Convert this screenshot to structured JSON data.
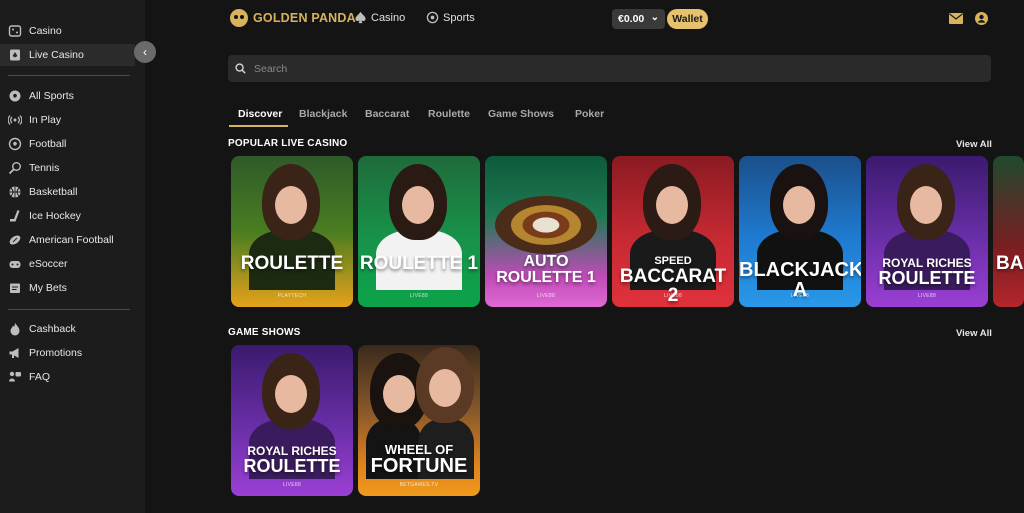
{
  "sidebar": {
    "items": [
      {
        "label": "Casino",
        "icon": "casino-icon"
      },
      {
        "label": "Live Casino",
        "icon": "live-casino-icon"
      },
      {
        "label": "All Sports",
        "icon": "all-sports-icon"
      },
      {
        "label": "In Play",
        "icon": "in-play-icon"
      },
      {
        "label": "Football",
        "icon": "football-icon"
      },
      {
        "label": "Tennis",
        "icon": "tennis-icon"
      },
      {
        "label": "Basketball",
        "icon": "basketball-icon"
      },
      {
        "label": "Ice Hockey",
        "icon": "ice-hockey-icon"
      },
      {
        "label": "American Football",
        "icon": "american-football-icon"
      },
      {
        "label": "eSoccer",
        "icon": "esoccer-icon"
      },
      {
        "label": "My Bets",
        "icon": "my-bets-icon"
      },
      {
        "label": "Cashback",
        "icon": "cashback-icon"
      },
      {
        "label": "Promotions",
        "icon": "promotions-icon"
      },
      {
        "label": "FAQ",
        "icon": "faq-icon"
      }
    ],
    "active": "Live Casino",
    "collapse_glyph": "‹"
  },
  "header": {
    "logo": "GOLDEN PANDA",
    "nav": [
      "Casino",
      "Sports"
    ],
    "balance": "€0.00",
    "wallet_label": "Wallet",
    "dropdown_glyph": "⌄"
  },
  "search": {
    "placeholder": "Search"
  },
  "tabs": [
    "Discover",
    "Blackjack",
    "Baccarat",
    "Roulette",
    "Game Shows",
    "Poker"
  ],
  "sections": {
    "popular": {
      "title": "POPULAR LIVE CASINO",
      "view_all": "View All"
    },
    "game_shows": {
      "title": "GAME SHOWS",
      "view_all": "View All"
    }
  },
  "popular_games": [
    {
      "title": "ROULETTE",
      "provider": "PLAYTECH"
    },
    {
      "title": "ROULETTE 1",
      "provider": "LIVE88"
    },
    {
      "title": "AUTO ROULETTE 1",
      "provider": "LIVE88"
    },
    {
      "title_top": "SPEED",
      "title": "BACCARAT 2",
      "provider": "LIVE88"
    },
    {
      "title": "BLACKJACK A",
      "provider": "LIVE88"
    },
    {
      "title_top": "ROYAL RICHES",
      "title": "ROULETTE",
      "provider": "LIVE88"
    },
    {
      "title": "BA",
      "provider": ""
    }
  ],
  "game_show_games": [
    {
      "title_top": "ROYAL RICHES",
      "title": "ROULETTE",
      "provider": "LIVE88"
    },
    {
      "title_top": "WHEEL OF",
      "title": "FORTUNE",
      "provider": "BETGAMES.TV"
    }
  ],
  "colors": {
    "accent": "#d9b25e",
    "wallet": "#e6c26d",
    "background": "#141414",
    "sidebar": "#1c1c1c"
  }
}
